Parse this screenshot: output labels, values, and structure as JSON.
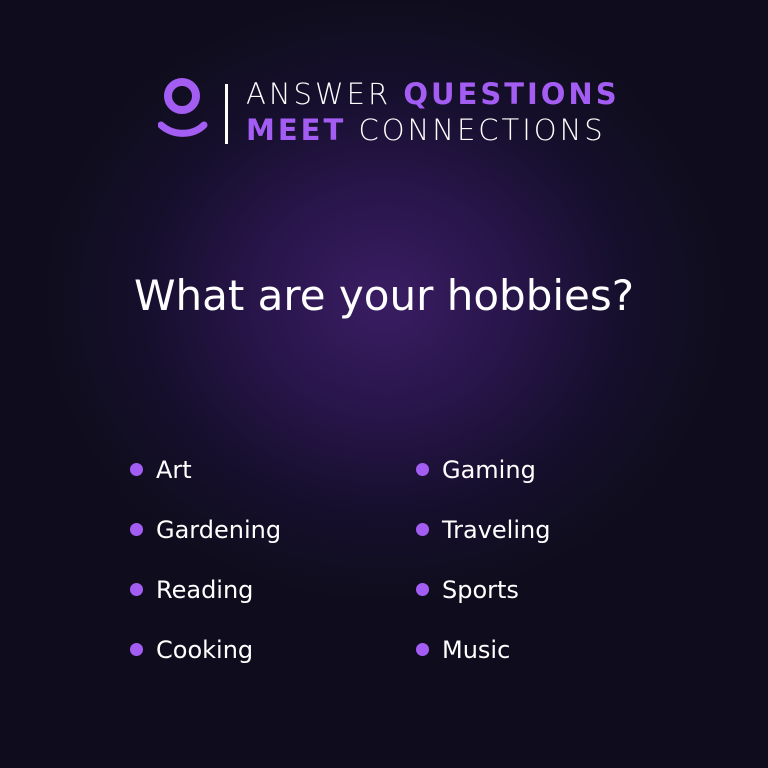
{
  "header": {
    "logo_icon": "user-icon",
    "tagline": {
      "line1": {
        "part1": "ANSWER",
        "part2": "QUESTIONS"
      },
      "line2": {
        "part1": "MEET",
        "part2": "CONNECTIONS"
      }
    }
  },
  "main": {
    "question": "What are your hobbies?"
  },
  "hobbies": {
    "column1": [
      {
        "label": "Art"
      },
      {
        "label": "Gardening"
      },
      {
        "label": "Reading"
      },
      {
        "label": "Cooking"
      }
    ],
    "column2": [
      {
        "label": "Gaming"
      },
      {
        "label": "Traveling"
      },
      {
        "label": "Sports"
      },
      {
        "label": "Music"
      }
    ]
  },
  "colors": {
    "accent": "#a45df3",
    "background": "#0f0d1d",
    "glow": "#3a1d63",
    "text": "#ffffff"
  }
}
